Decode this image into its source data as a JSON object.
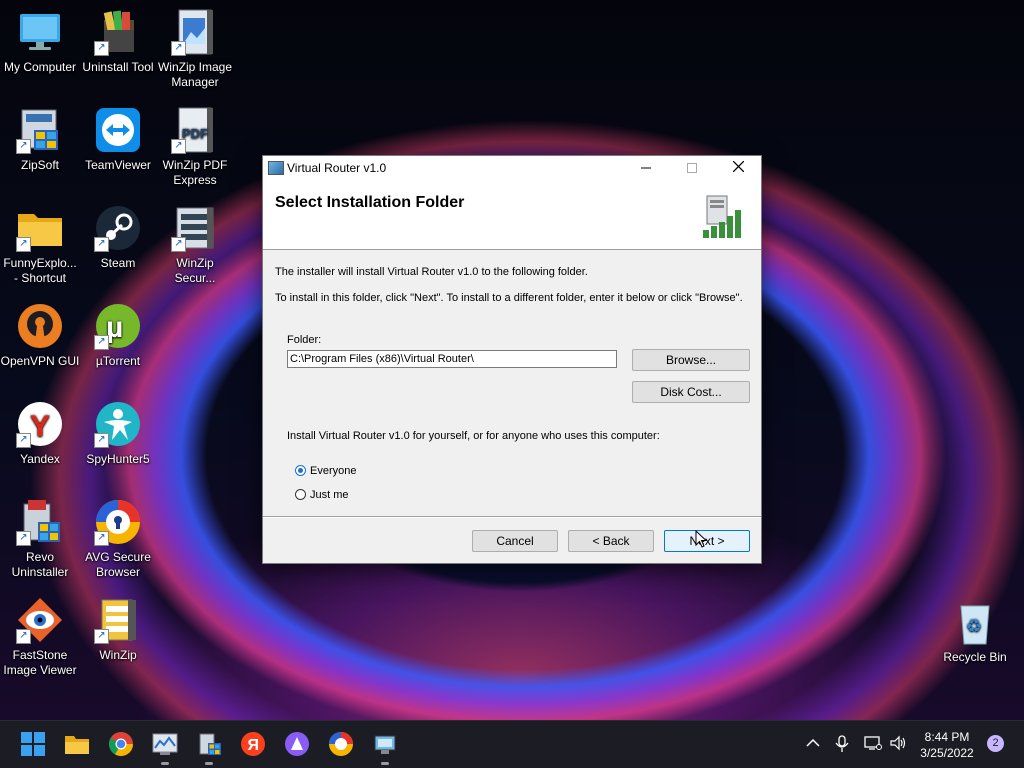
{
  "desktop": {
    "icons": [
      {
        "label": "My Computer",
        "icon": "computer-icon"
      },
      {
        "label": "Uninstall Tool",
        "icon": "uninstall-tool-icon"
      },
      {
        "label": "WinZip Image Manager",
        "icon": "winzip-image-icon"
      },
      {
        "label": "ZipSoft",
        "icon": "zipsoft-icon"
      },
      {
        "label": "TeamViewer",
        "icon": "teamviewer-icon"
      },
      {
        "label": "WinZip PDF Express",
        "icon": "winzip-pdf-icon"
      },
      {
        "label": "FunnyExplo... - Shortcut",
        "icon": "folder-icon"
      },
      {
        "label": "Steam",
        "icon": "steam-icon"
      },
      {
        "label": "WinZip Secur...",
        "icon": "winzip-secure-icon"
      },
      {
        "label": "OpenVPN GUI",
        "icon": "openvpn-icon"
      },
      {
        "label": "µTorrent",
        "icon": "utorrent-icon"
      },
      {
        "label": "Yandex",
        "icon": "yandex-icon"
      },
      {
        "label": "SpyHunter5",
        "icon": "spyhunter-icon"
      },
      {
        "label": "Revo Uninstaller",
        "icon": "revo-icon"
      },
      {
        "label": "AVG Secure Browser",
        "icon": "avg-browser-icon"
      },
      {
        "label": "FastStone Image Viewer",
        "icon": "faststone-icon"
      },
      {
        "label": "WinZip",
        "icon": "winzip-icon"
      }
    ],
    "recycle_bin": "Recycle Bin"
  },
  "dialog": {
    "title": "Virtual Router v1.0",
    "heading": "Select Installation Folder",
    "intro": "The installer will install Virtual Router v1.0 to the following folder.",
    "instructions": "To install in this folder, click \"Next\". To install to a different folder, enter it below or click \"Browse\".",
    "folder_label": "Folder:",
    "folder_value": "C:\\Program Files (x86)\\Virtual Router\\",
    "browse_label": "Browse...",
    "disk_cost_label": "Disk Cost...",
    "install_for_label": "Install Virtual Router v1.0 for yourself, or for anyone who uses this computer:",
    "options": [
      {
        "label": "Everyone",
        "selected": true
      },
      {
        "label": "Just me",
        "selected": false
      }
    ],
    "cancel_label": "Cancel",
    "back_label": "< Back",
    "next_label": "Next >"
  },
  "taskbar": {
    "apps": [
      "start-icon",
      "file-explorer-icon",
      "chrome-icon",
      "task-monitor-icon",
      "installer-icon",
      "yandex-icon",
      "alice-icon",
      "avg-browser-icon",
      "virtual-router-icon"
    ],
    "time": "8:44 PM",
    "date": "3/25/2022",
    "notifications": "2"
  },
  "colors": {
    "accent": "#0078d7",
    "taskbar_bg": "#1c1c24",
    "dialog_bg": "#f0f0f0"
  }
}
